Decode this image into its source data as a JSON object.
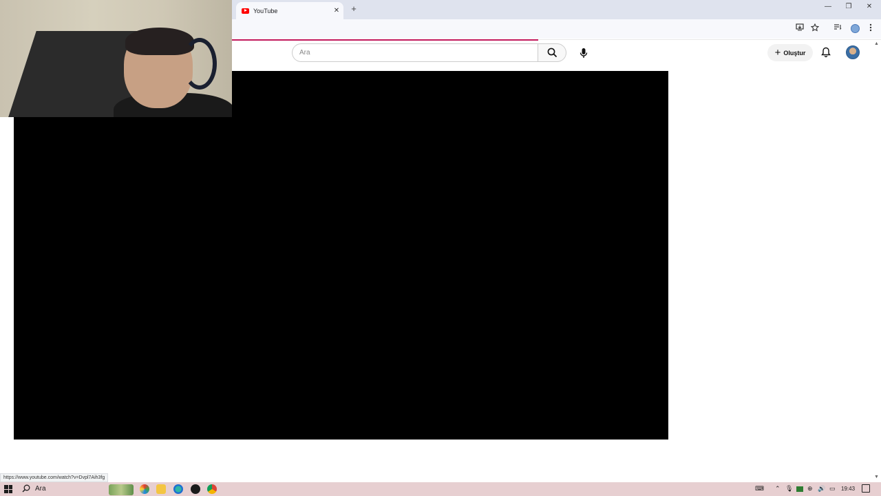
{
  "browser": {
    "tab_title": "YouTube",
    "tab_close": "✕",
    "new_tab": "+",
    "window_controls": {
      "minimize": "—",
      "restore": "❐",
      "close": "✕"
    },
    "toolbar_icons": [
      "install-app-icon",
      "bookmark-star-icon",
      "reading-list-icon",
      "profile-icon",
      "menu-dots-icon"
    ],
    "loading_color": "#c2185b",
    "status_url": "https://www.youtube.com/watch?v=Dvpl7Aih3fg"
  },
  "youtube": {
    "search_placeholder": "Ara",
    "create_label": "Oluştur",
    "brand_color": "#ff0000"
  },
  "taskbar": {
    "search_label": "Ara",
    "clock": "19:43",
    "background": "#e7cfd1"
  }
}
